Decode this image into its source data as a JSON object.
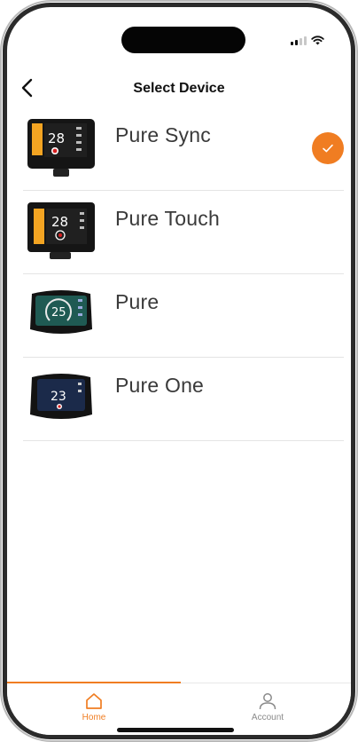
{
  "header": {
    "title": "Select Device"
  },
  "devices": [
    {
      "name": "Pure Sync",
      "selected": true,
      "screen_value": "28"
    },
    {
      "name": "Pure Touch",
      "selected": false,
      "screen_value": "28"
    },
    {
      "name": "Pure",
      "selected": false,
      "screen_value": "25"
    },
    {
      "name": "Pure One",
      "selected": false,
      "screen_value": "23"
    }
  ],
  "tabs": [
    {
      "label": "Home",
      "active": true
    },
    {
      "label": "Account",
      "active": false
    }
  ],
  "colors": {
    "accent": "#f07d22",
    "text": "#3a3a3a",
    "inactive": "#8a8a8a"
  }
}
